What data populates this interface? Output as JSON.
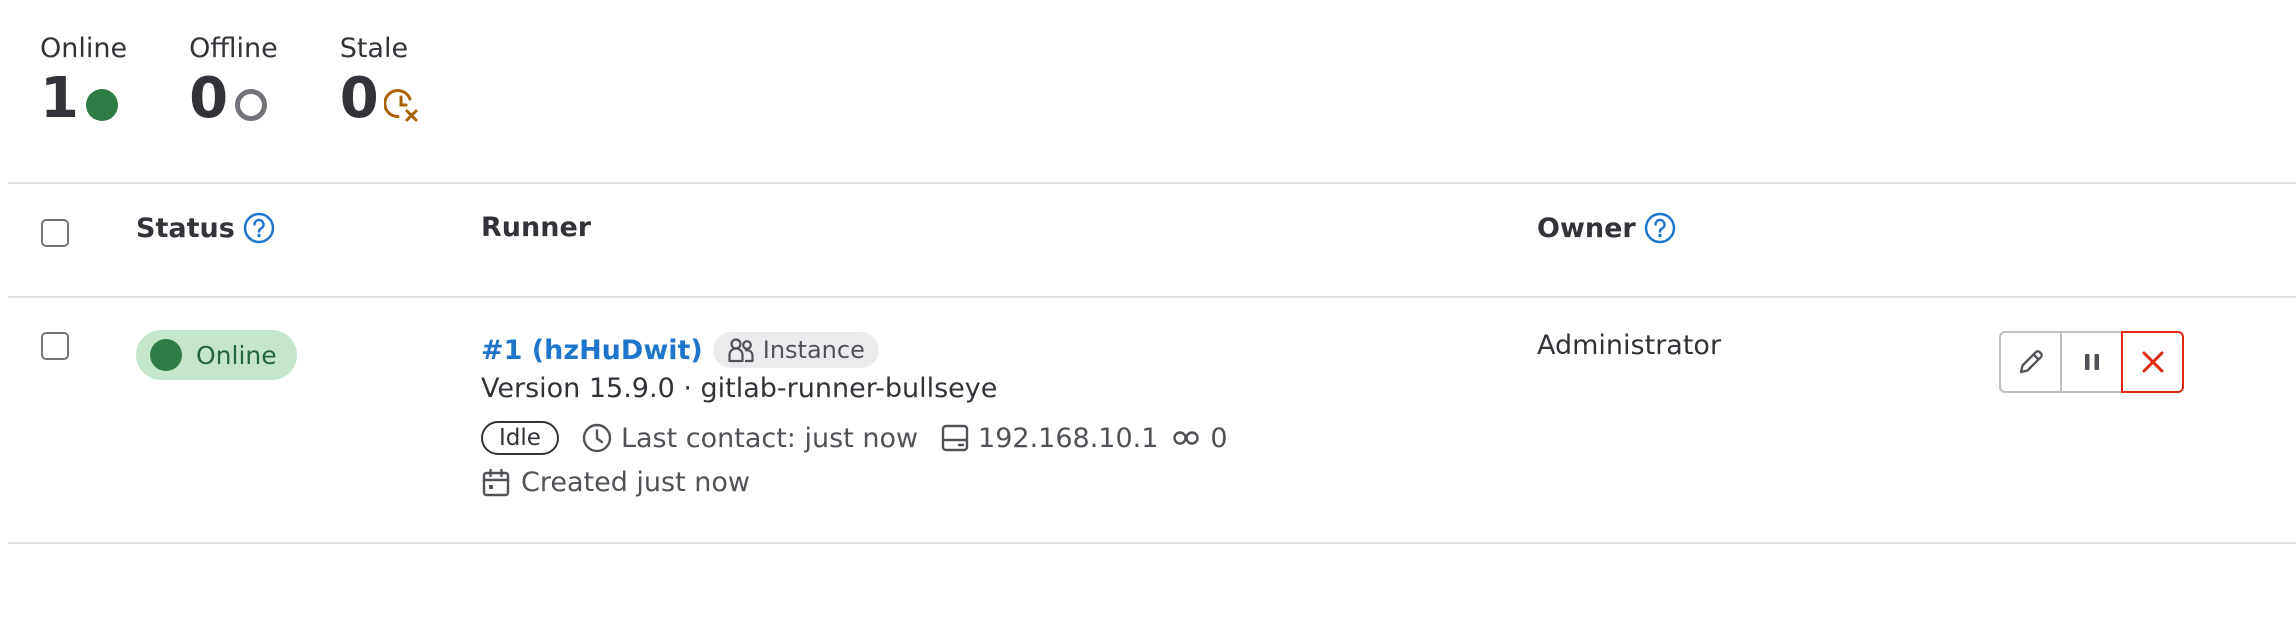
{
  "stats": [
    {
      "label": "Online",
      "value": "1",
      "icon": "status-online-icon",
      "color": "#2f7b45"
    },
    {
      "label": "Offline",
      "value": "0",
      "icon": "status-offline-icon",
      "color": "#737278"
    },
    {
      "label": "Stale",
      "value": "0",
      "icon": "status-stale-icon",
      "color": "#ab6100"
    }
  ],
  "table": {
    "headers": {
      "status": "Status",
      "runner": "Runner",
      "owner": "Owner"
    },
    "rows": [
      {
        "status": "Online",
        "runner_name": "#1 (hzHuDwit)",
        "runner_type": "Instance",
        "version": "Version 15.9.0 · gitlab-runner-bullseye",
        "job_status": "Idle",
        "last_contact": "Last contact: just now",
        "ip": "192.168.10.1",
        "jobs_count": "0",
        "created": "Created just now",
        "owner": "Administrator"
      }
    ]
  },
  "colors": {
    "online": "#2f7b45",
    "online_bg": "#c3e6cd",
    "link": "#1f75cb",
    "danger": "#dd2b0e",
    "help": "#1f75cb"
  }
}
